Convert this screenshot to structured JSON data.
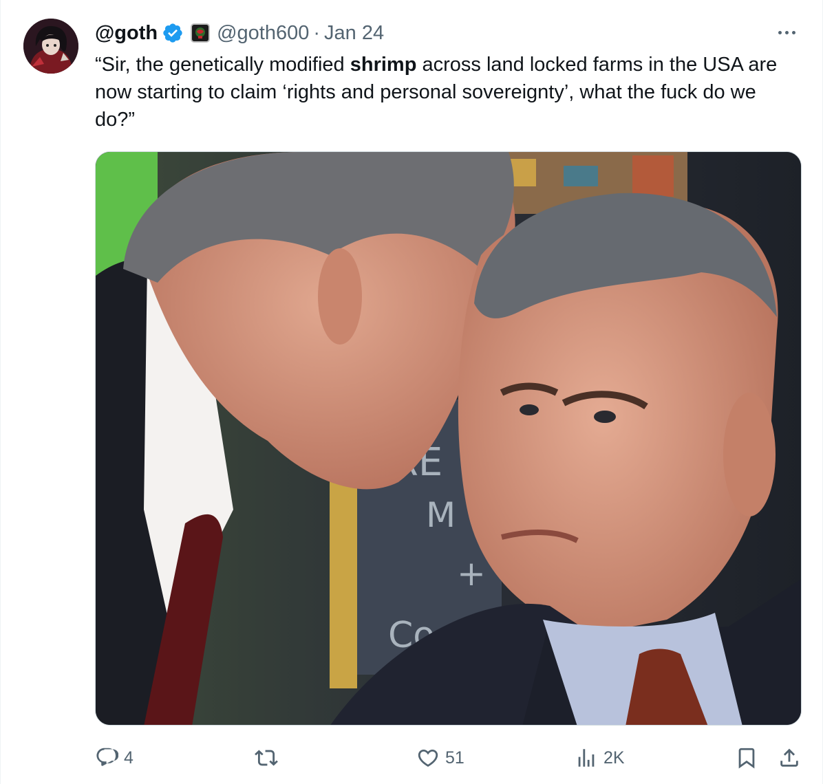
{
  "tweet": {
    "display_name": "@goth",
    "handle": "@goth600",
    "separator": "·",
    "date": "Jan 24",
    "text_before": "“Sir, the genetically modified ",
    "text_bold": "shrimp",
    "text_after": " across land locked farms in the USA are now starting to claim ‘rights and personal sovereignty’, what the fuck do we do?”",
    "media": {
      "chalkboard_lines": [
        "RE",
        "M",
        "+",
        "Co"
      ]
    }
  },
  "actions": {
    "reply_count": "4",
    "repost_count": "",
    "like_count": "51",
    "views_count": "2K"
  },
  "icons": [
    "verified-badge-icon",
    "affiliate-badge-icon",
    "more-icon",
    "reply-icon",
    "repost-icon",
    "like-icon",
    "views-icon",
    "bookmark-icon",
    "share-icon"
  ],
  "colors": {
    "verified": "#1d9bf0",
    "secondary_text": "#536471",
    "primary_text": "#0f1419"
  }
}
